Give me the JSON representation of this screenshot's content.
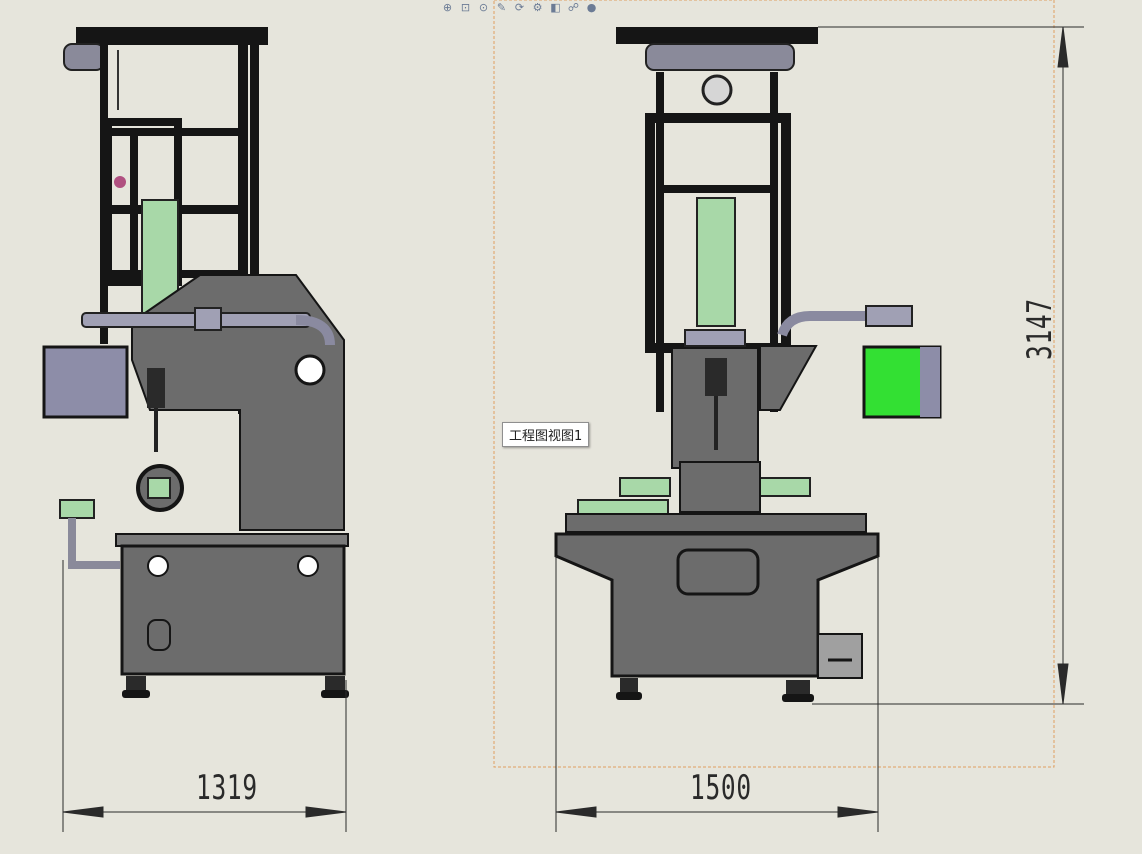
{
  "drawing": {
    "view_label": "工程图视图1",
    "dimensions": {
      "left_width": "1319",
      "right_width": "1500",
      "height": "3147"
    },
    "colors": {
      "background": "#e6e5dc",
      "body_gray": "#6c6c6c",
      "frame_black": "#151515",
      "cylinder_green": "#a8d8a8",
      "box_lavender": "#8d8da8",
      "box_green": "#33e033",
      "view_boundary": "#e0a060"
    }
  },
  "toolbar": {
    "icons": [
      {
        "name": "zoom-to-fit-icon",
        "glyph": "⊕"
      },
      {
        "name": "zoom-area-icon",
        "glyph": "⊡"
      },
      {
        "name": "zoom-in-out-icon",
        "glyph": "⊙"
      },
      {
        "name": "pan-icon",
        "glyph": "✎"
      },
      {
        "name": "rotate-icon",
        "glyph": "⟳"
      },
      {
        "name": "view-settings-icon",
        "glyph": "⚙"
      },
      {
        "name": "display-style-icon",
        "glyph": "◧"
      },
      {
        "name": "hide-show-icon",
        "glyph": "☍"
      },
      {
        "name": "appearance-icon",
        "glyph": "●"
      }
    ]
  }
}
